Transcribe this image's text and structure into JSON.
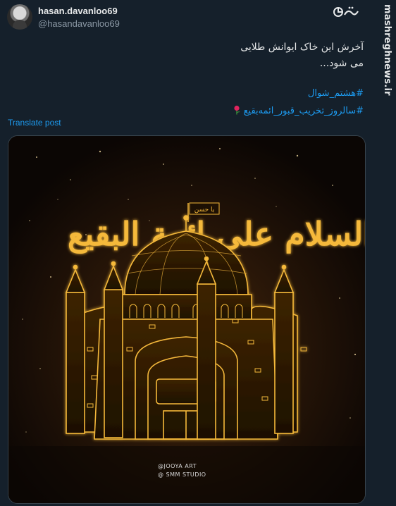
{
  "author": {
    "display_name": "hasan.davanloo69",
    "handle": "@hasandavanloo69"
  },
  "post": {
    "text_line1": "آخرش این خاک ایوانش طلایی",
    "text_line2": "می شود...",
    "hashtags": [
      "#هشتم_شوال",
      "#سالروز_تخریب_قبور_ائمه‌بقیع"
    ],
    "translate_label": "Translate post"
  },
  "image": {
    "calligraphy_title": "السلام علی ائمة البقیع",
    "flag_text": "یا حسن",
    "credits": [
      "@JOOYA ART",
      "@ SMM STUDIO"
    ]
  },
  "watermark": {
    "site": "mashreghnews.ir",
    "logo_text": "مشرق"
  },
  "colors": {
    "background": "#15202b",
    "link": "#1d9bf0",
    "gold": "#f5b93a"
  }
}
